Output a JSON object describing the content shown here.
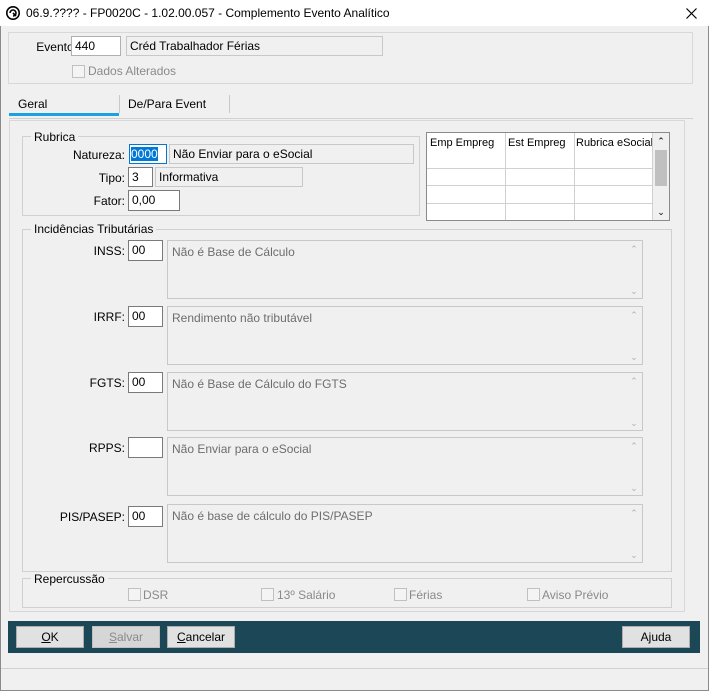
{
  "window": {
    "title": "06.9.???? - FP0020C - 1.02.00.057 - Complemento Evento Analítico",
    "close_glyph": "✕"
  },
  "header": {
    "evento_label": "Evento:",
    "evento_code": "440",
    "evento_desc": "Créd Trabalhador Férias",
    "dados_alterados_label": "Dados Alterados"
  },
  "tabs": [
    {
      "label": "Geral",
      "active": true
    },
    {
      "label": "De/Para Event",
      "active": false
    }
  ],
  "rubrica": {
    "group_label": "Rubrica",
    "natureza_label": "Natureza:",
    "natureza_value": "0000",
    "natureza_desc": "Não Enviar para o eSocial",
    "tipo_label": "Tipo:",
    "tipo_value": "3",
    "tipo_desc": "Informativa",
    "fator_label": "Fator:",
    "fator_value": "0,00"
  },
  "grid": {
    "columns": [
      "Emp Empreg",
      "Est Empreg",
      "Rubrica eSocial"
    ],
    "rows": [
      [
        "",
        "",
        ""
      ],
      [
        "",
        "",
        ""
      ]
    ]
  },
  "incidencias": {
    "group_label": "Incidências Tributárias",
    "items": [
      {
        "label": "INSS:",
        "code": "00",
        "desc": "Não é Base de Cálculo"
      },
      {
        "label": "IRRF:",
        "code": "00",
        "desc": "Rendimento não tributável"
      },
      {
        "label": "FGTS:",
        "code": "00",
        "desc": "Não é Base de Cálculo do FGTS"
      },
      {
        "label": "RPPS:",
        "code": "",
        "desc": "Não Enviar para o eSocial"
      },
      {
        "label": "PIS/PASEP:",
        "code": "00",
        "desc": "Não é base de cálculo do PIS/PASEP"
      }
    ]
  },
  "repercussao": {
    "group_label": "Repercussão",
    "options": [
      "DSR",
      "13º Salário",
      "Férias",
      "Aviso Prévio"
    ]
  },
  "buttons": {
    "ok": "OK",
    "ok_key": "O",
    "ok_rest": "K",
    "salvar": "Salvar",
    "salvar_key": "S",
    "salvar_rest": "alvar",
    "cancelar": "Cancelar",
    "cancelar_key": "C",
    "cancelar_rest": "ancelar",
    "ajuda": "Ajuda",
    "ajuda_head": "A",
    "ajuda_key": "j",
    "ajuda_rest": "uda"
  },
  "colors": {
    "footer": "#1c4757",
    "tab_underline": "#1ba1e2",
    "selection": "#0078d7"
  }
}
